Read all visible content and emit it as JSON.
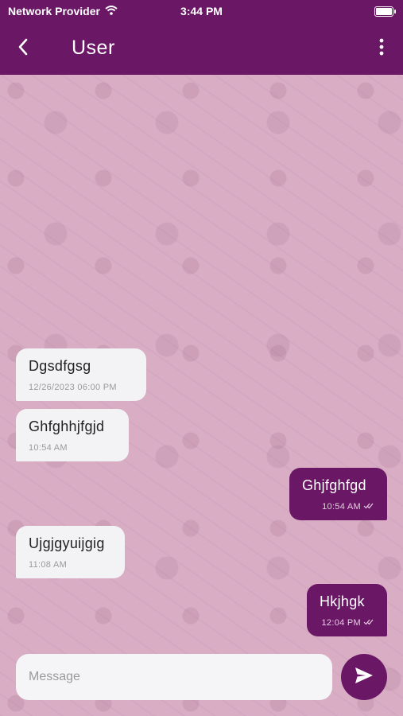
{
  "status": {
    "carrier": "Network Provider",
    "time": "3:44 PM"
  },
  "header": {
    "title": "User"
  },
  "messages": [
    {
      "direction": "in",
      "text": "Dgsdfgsg",
      "time": "12/26/2023 06:00 PM"
    },
    {
      "direction": "in",
      "text": "Ghfghhjfgjd",
      "time": "10:54 AM"
    },
    {
      "direction": "out",
      "text": "Ghjfghfgd",
      "time": "10:54 AM"
    },
    {
      "direction": "in",
      "text": "Ujgjgyuijgig",
      "time": "11:08 AM"
    },
    {
      "direction": "out",
      "text": "Hkjhgk",
      "time": "12:04 PM"
    }
  ],
  "composer": {
    "placeholder": "Message",
    "value": ""
  },
  "colors": {
    "primary": "#6a1766",
    "background": "#d9aec5",
    "incoming_bubble": "#f3f3f5"
  },
  "icons": {
    "back": "chevron-left-icon",
    "menu": "more-vertical-icon",
    "send": "send-icon",
    "wifi": "wifi-icon",
    "battery": "battery-icon",
    "read": "double-check-icon"
  }
}
